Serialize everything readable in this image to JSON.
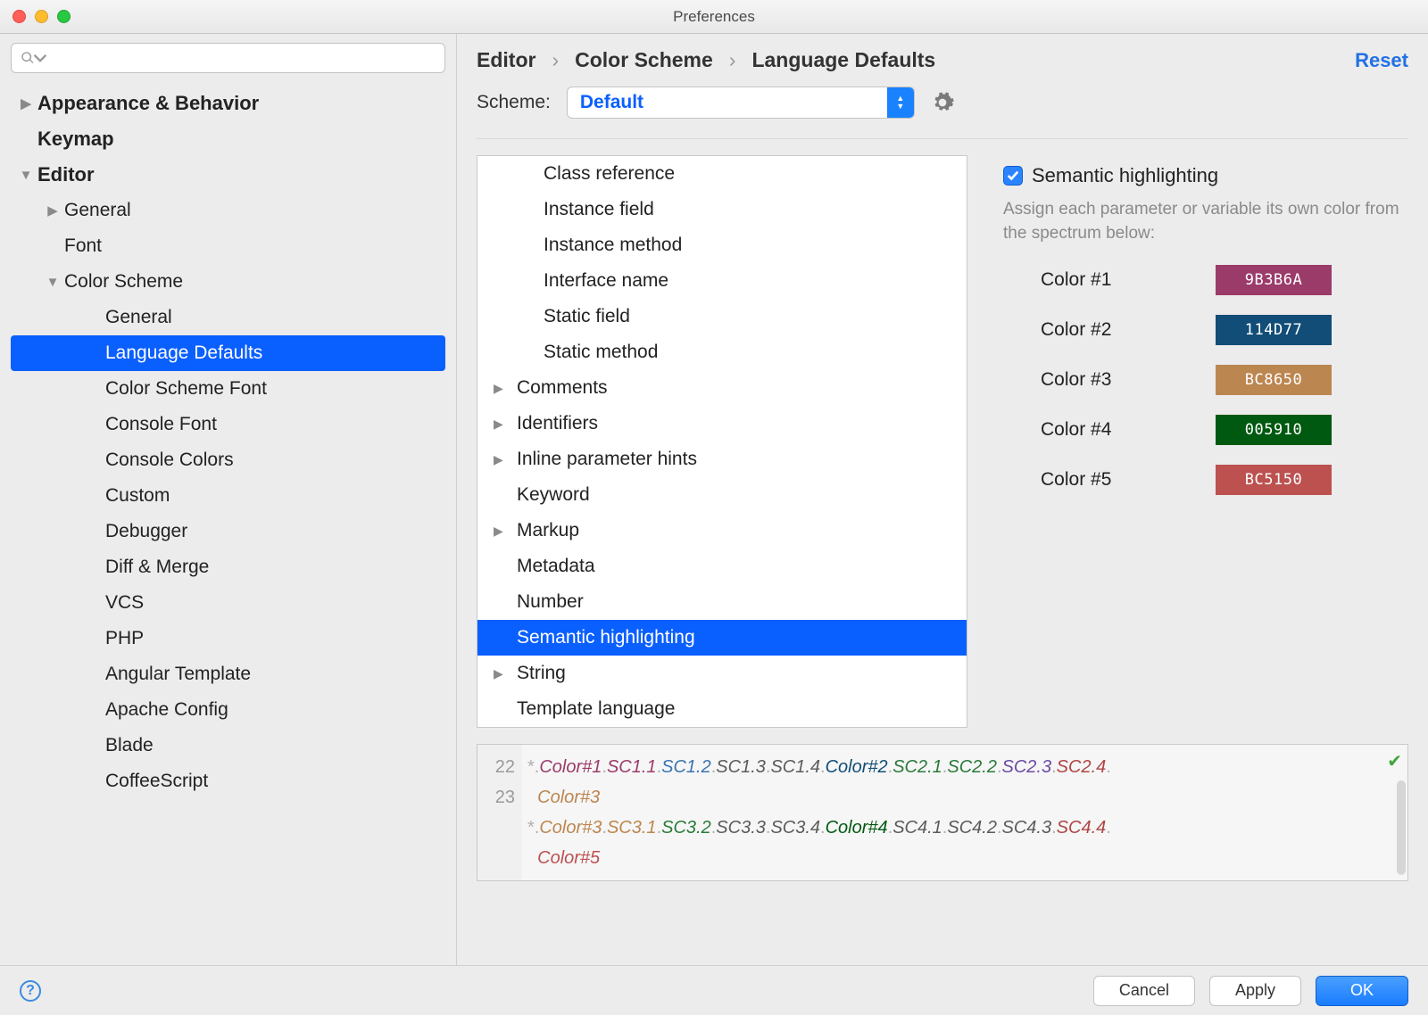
{
  "window": {
    "title": "Preferences"
  },
  "sidebar": {
    "search_placeholder": "",
    "items": [
      {
        "label": "Appearance & Behavior",
        "level": 0,
        "bold": true,
        "arrow": "right"
      },
      {
        "label": "Keymap",
        "level": 0,
        "bold": true,
        "arrow": "none"
      },
      {
        "label": "Editor",
        "level": 0,
        "bold": true,
        "arrow": "down"
      },
      {
        "label": "General",
        "level": 1,
        "bold": false,
        "arrow": "right"
      },
      {
        "label": "Font",
        "level": 1,
        "bold": false,
        "arrow": "none"
      },
      {
        "label": "Color Scheme",
        "level": 1,
        "bold": false,
        "arrow": "down"
      },
      {
        "label": "General",
        "level": 2,
        "bold": false,
        "arrow": "none"
      },
      {
        "label": "Language Defaults",
        "level": 2,
        "bold": false,
        "arrow": "none",
        "selected": true
      },
      {
        "label": "Color Scheme Font",
        "level": 2,
        "bold": false,
        "arrow": "none"
      },
      {
        "label": "Console Font",
        "level": 2,
        "bold": false,
        "arrow": "none"
      },
      {
        "label": "Console Colors",
        "level": 2,
        "bold": false,
        "arrow": "none"
      },
      {
        "label": "Custom",
        "level": 2,
        "bold": false,
        "arrow": "none"
      },
      {
        "label": "Debugger",
        "level": 2,
        "bold": false,
        "arrow": "none"
      },
      {
        "label": "Diff & Merge",
        "level": 2,
        "bold": false,
        "arrow": "none"
      },
      {
        "label": "VCS",
        "level": 2,
        "bold": false,
        "arrow": "none"
      },
      {
        "label": "PHP",
        "level": 2,
        "bold": false,
        "arrow": "none"
      },
      {
        "label": "Angular Template",
        "level": 2,
        "bold": false,
        "arrow": "none"
      },
      {
        "label": "Apache Config",
        "level": 2,
        "bold": false,
        "arrow": "none"
      },
      {
        "label": "Blade",
        "level": 2,
        "bold": false,
        "arrow": "none"
      },
      {
        "label": "CoffeeScript",
        "level": 2,
        "bold": false,
        "arrow": "none"
      }
    ]
  },
  "breadcrumbs": [
    "Editor",
    "Color Scheme",
    "Language Defaults"
  ],
  "reset_label": "Reset",
  "scheme": {
    "label": "Scheme:",
    "value": "Default"
  },
  "categories": [
    {
      "label": "Class reference",
      "indent": 1,
      "arrow": false
    },
    {
      "label": "Instance field",
      "indent": 1,
      "arrow": false
    },
    {
      "label": "Instance method",
      "indent": 1,
      "arrow": false
    },
    {
      "label": "Interface name",
      "indent": 1,
      "arrow": false
    },
    {
      "label": "Static field",
      "indent": 1,
      "arrow": false
    },
    {
      "label": "Static method",
      "indent": 1,
      "arrow": false
    },
    {
      "label": "Comments",
      "indent": 0,
      "arrow": true
    },
    {
      "label": "Identifiers",
      "indent": 0,
      "arrow": true
    },
    {
      "label": "Inline parameter hints",
      "indent": 0,
      "arrow": true
    },
    {
      "label": "Keyword",
      "indent": 0,
      "arrow": false
    },
    {
      "label": "Markup",
      "indent": 0,
      "arrow": true
    },
    {
      "label": "Metadata",
      "indent": 0,
      "arrow": false
    },
    {
      "label": "Number",
      "indent": 0,
      "arrow": false
    },
    {
      "label": "Semantic highlighting",
      "indent": 0,
      "arrow": false,
      "selected": true
    },
    {
      "label": "String",
      "indent": 0,
      "arrow": true
    },
    {
      "label": "Template language",
      "indent": 0,
      "arrow": false
    }
  ],
  "semantic": {
    "checkbox_label": "Semantic highlighting",
    "help": "Assign each parameter or variable its own color from the spectrum below:",
    "colors": [
      {
        "label": "Color #1",
        "hex": "9B3B6A",
        "bg": "#9B3B6A"
      },
      {
        "label": "Color #2",
        "hex": "114D77",
        "bg": "#114D77"
      },
      {
        "label": "Color #3",
        "hex": "BC8650",
        "bg": "#BC8650"
      },
      {
        "label": "Color #4",
        "hex": "005910",
        "bg": "#005910"
      },
      {
        "label": "Color #5",
        "hex": "BC5150",
        "bg": "#BC5150"
      }
    ]
  },
  "preview": {
    "lines": [
      22,
      23
    ],
    "l1": {
      "star": "*",
      "c1": "Color#1",
      "s11": "SC1.1",
      "s12": "SC1.2",
      "s13": "SC1.3",
      "s14": "SC1.4",
      "c2": "Color#2",
      "s21": "SC2.1",
      "s22": "SC2.2",
      "s23": "SC2.3",
      "s24": "SC2.4",
      "c3": "Color#3"
    },
    "l2": {
      "star": "*",
      "c3": "Color#3",
      "s31": "SC3.1",
      "s32": "SC3.2",
      "s33": "SC3.3",
      "s34": "SC3.4",
      "c4": "Color#4",
      "s41": "SC4.1",
      "s42": "SC4.2",
      "s43": "SC4.3",
      "s44": "SC4.4",
      "c5": "Color#5"
    }
  },
  "footer": {
    "cancel": "Cancel",
    "apply": "Apply",
    "ok": "OK"
  }
}
